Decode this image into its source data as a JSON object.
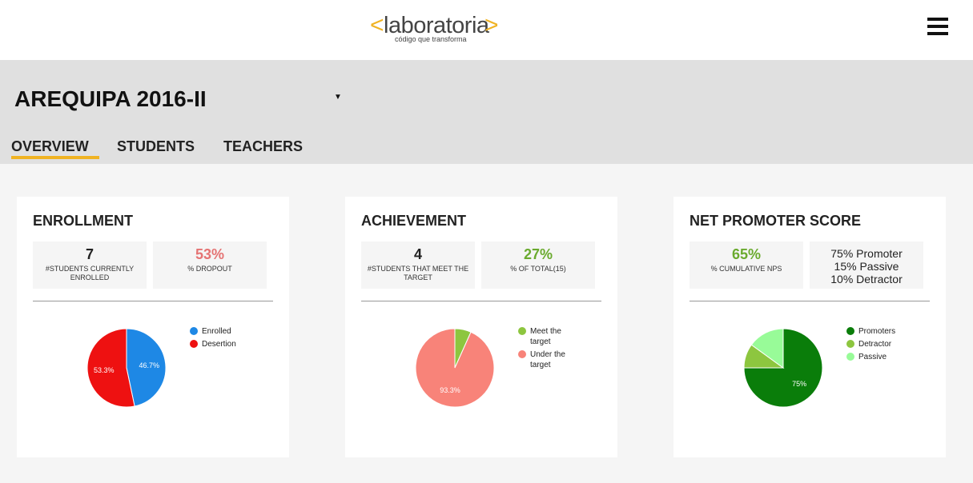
{
  "brand": {
    "bracket_left": "<",
    "name": "laboratoria",
    "bracket_right": ">",
    "tagline": "código que transforma"
  },
  "header": {
    "cohort": "AREQUIPA 2016-II",
    "dropdown_arrow": "▼"
  },
  "tabs": [
    {
      "label": "OVERVIEW",
      "active": true
    },
    {
      "label": "STUDENTS",
      "active": false
    },
    {
      "label": "TEACHERS",
      "active": false
    }
  ],
  "colors": {
    "accent": "#f0b323",
    "dropout_red": "#e57373",
    "positive_green": "#6aaa2e"
  },
  "cards": {
    "enrollment": {
      "title": "ENROLLMENT",
      "stat_a": {
        "value": "7",
        "label": "#STUDENTS CURRENTLY ENROLLED"
      },
      "stat_b": {
        "value": "53%",
        "label": "% DROPOUT"
      }
    },
    "achievement": {
      "title": "ACHIEVEMENT",
      "stat_a": {
        "value": "4",
        "label": "#STUDENTS THAT MEET THE TARGET"
      },
      "stat_b": {
        "value": "27%",
        "label": "% OF TOTAL(15)"
      }
    },
    "nps": {
      "title": "NET PROMOTER SCORE",
      "stat_a": {
        "value": "65%",
        "label": "% CUMULATIVE NPS"
      },
      "stat_b": {
        "line1": "75% Promoter",
        "line2": "15% Passive",
        "line3": "10% Detractor"
      }
    }
  },
  "chart_data": [
    {
      "type": "pie",
      "categories": [
        "Enrolled",
        "Desertion"
      ],
      "values": [
        46.7,
        53.3
      ],
      "colors": [
        "#1e88e5",
        "#ee1111"
      ],
      "data_labels": [
        "46.7%",
        "53.3%"
      ]
    },
    {
      "type": "pie",
      "categories": [
        "Meet the target",
        "Under the target"
      ],
      "values": [
        6.7,
        93.3
      ],
      "colors": [
        "#8dc63f",
        "#f88379"
      ],
      "data_labels": [
        "",
        "93.3%"
      ]
    },
    {
      "type": "pie",
      "categories": [
        "Promoters",
        "Detractor",
        "Passive"
      ],
      "values": [
        75,
        10,
        15
      ],
      "colors": [
        "#0a7d0a",
        "#8dc63f",
        "#98fb98"
      ],
      "data_labels": [
        "75%",
        "",
        ""
      ]
    }
  ]
}
